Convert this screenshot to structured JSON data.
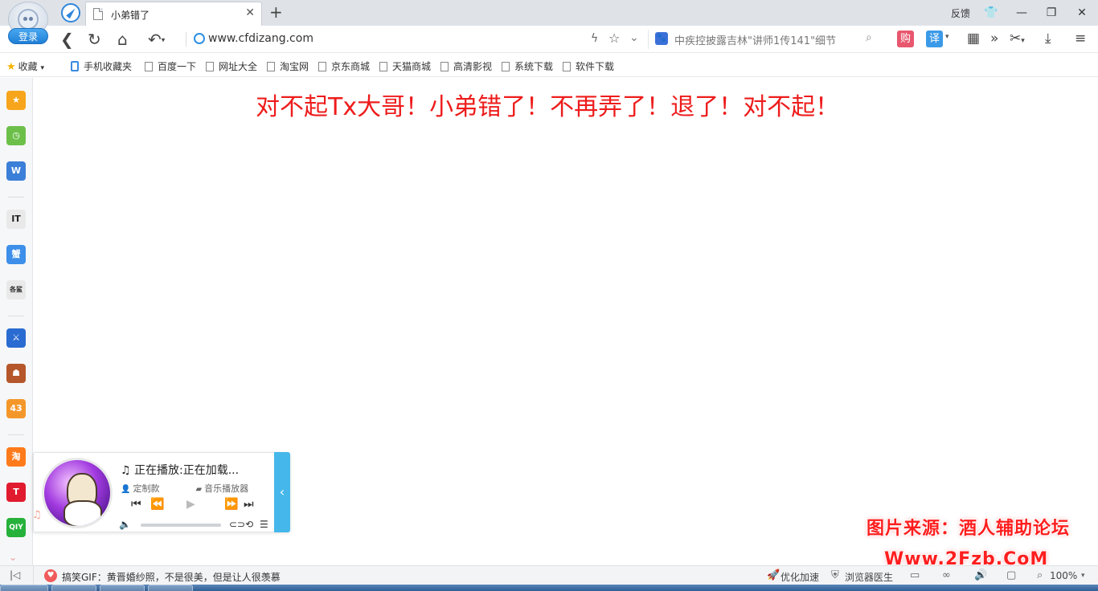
{
  "header": {
    "login_label": "登录",
    "tab_title": "小弟错了",
    "feedback_label": "反馈"
  },
  "navbar": {
    "url": "www.cfdizang.com",
    "search_placeholder": "中疾控披露吉林\"讲师1传141\"细节",
    "gou_label": "购",
    "yi_label": "译"
  },
  "bookmarks": {
    "favorites_label": "收藏",
    "items": [
      "手机收藏夹",
      "百度一下",
      "网址大全",
      "淘宝网",
      "京东商城",
      "天猫商城",
      "高清影视",
      "系统下载",
      "软件下载"
    ]
  },
  "sidebar": {
    "items": [
      {
        "name": "favorites",
        "label": "★",
        "color": "#f7a51c"
      },
      {
        "name": "history",
        "label": "◷",
        "color": "#6cc04a"
      },
      {
        "name": "word-doc",
        "label": "W",
        "color": "#3b7fd8"
      },
      {
        "name": "it-news",
        "label": "IT",
        "color": "#e9e9e9"
      },
      {
        "name": "crab",
        "label": "蟹",
        "color": "#3d8fea"
      },
      {
        "name": "helper",
        "label": "各鲨",
        "color": "#e9e9e9"
      },
      {
        "name": "game-sword",
        "label": "⚔",
        "color": "#2a6bd1"
      },
      {
        "name": "game-legend",
        "label": "☗",
        "color": "#b5572a"
      },
      {
        "name": "game-4399",
        "label": "43",
        "color": "#f4972a"
      },
      {
        "name": "taobao",
        "label": "淘",
        "color": "#ff7a1a"
      },
      {
        "name": "tmall",
        "label": "T",
        "color": "#e11b2f"
      },
      {
        "name": "iqiyi",
        "label": "QIY",
        "color": "#26b13b"
      }
    ]
  },
  "main": {
    "heading": "对不起Tx大哥！小弟错了！不再弄了！退了！对不起！"
  },
  "player": {
    "now_playing": "正在播放:正在加载...",
    "custom_label": "定制款",
    "player_label": "音乐播放器",
    "progress": 0
  },
  "watermark": {
    "line1": "图片来源：酒人辅助论坛",
    "line2": "Www.2Fzb.CoM"
  },
  "statusbar": {
    "news": "搞笑GIF：黄晋婚纱照，不是很美，但是让人很羡慕",
    "optimize_label": "优化加速",
    "doctor_label": "浏览器医生",
    "zoom": "100%"
  }
}
